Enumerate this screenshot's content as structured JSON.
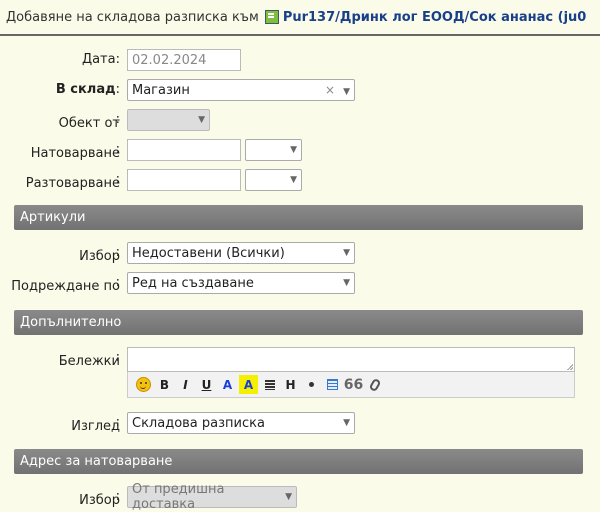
{
  "titlebar": {
    "prefix": "Добавяне на складова разписка към",
    "link": "Pur137/Дринк лог ЕООД/Сок ананас (ju0"
  },
  "form": {
    "date": {
      "label": "Дата",
      "placeholder": "02.02.2024"
    },
    "warehouse": {
      "label": "В склад",
      "value": "Магазин"
    },
    "object": {
      "label": "Обект от",
      "value": ""
    },
    "loading": {
      "label": "Натоварване"
    },
    "unloading": {
      "label": "Разтоварване"
    }
  },
  "sections": {
    "articles": "Артикули",
    "additional": "Допълнително",
    "address": "Адрес за натоварване"
  },
  "articles": {
    "choice": {
      "label": "Избор",
      "value": "Недоставени (Всички)"
    },
    "order": {
      "label": "Подреждане по",
      "value": "Ред на създаване"
    }
  },
  "additional": {
    "notes": {
      "label": "Бележки"
    },
    "toolbar": {
      "bold": "B",
      "italic": "I",
      "underline": "U",
      "color": "A",
      "highlight": "A",
      "heading": "H",
      "quote": "66"
    },
    "view": {
      "label": "Изглед",
      "value": "Складова разписка"
    }
  },
  "address": {
    "choice": {
      "label": "Избор",
      "value": "От предишна доставка"
    }
  },
  "colors": {
    "background": "#fbfbe9",
    "section_header": "#7d7d7d",
    "link": "#1a3f8a"
  }
}
